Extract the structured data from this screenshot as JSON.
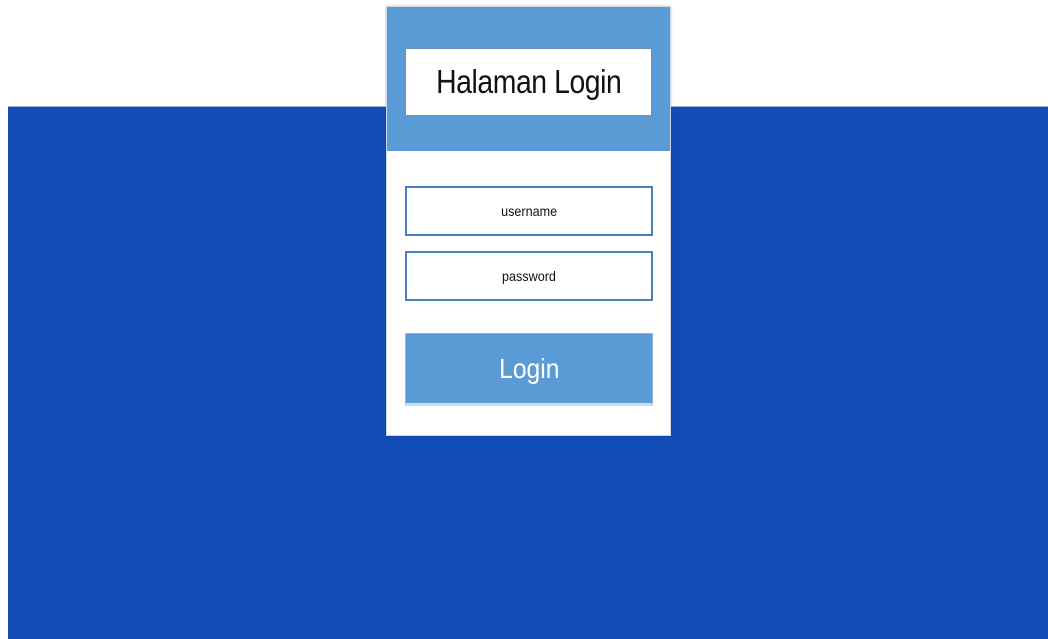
{
  "login_card": {
    "title": "Halaman Login",
    "username_placeholder": "username",
    "password_placeholder": "password",
    "login_label": "Login"
  },
  "colors": {
    "backdrop": "#114cb6",
    "header": "#5b9bd5",
    "button": "#5b9bd5",
    "field_border": "#4a7fc1"
  }
}
